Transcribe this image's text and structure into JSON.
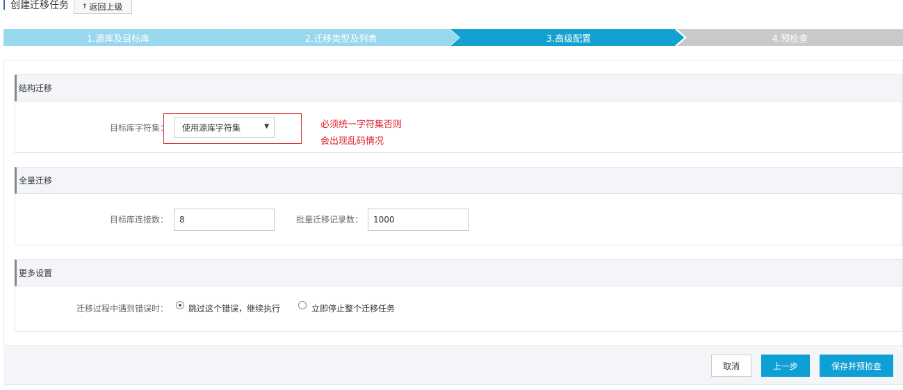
{
  "header": {
    "title": "创建迁移任务",
    "back_label": "返回上级"
  },
  "steps": [
    {
      "label": "1.源库及目标库",
      "state": "done"
    },
    {
      "label": "2.迁移类型及列表",
      "state": "done"
    },
    {
      "label": "3.高级配置",
      "state": "active"
    },
    {
      "label": "4.预检查",
      "state": "pending"
    }
  ],
  "colors": {
    "step_done": "#99d7ef",
    "step_active": "#12a1d1",
    "step_pending": "#c9c9c9",
    "primary_button": "#0e9fd4",
    "annotation_red": "#d9262d"
  },
  "structure_migration": {
    "heading": "结构迁移",
    "charset_label": "目标库字符集：",
    "charset_value": "使用源库字符集",
    "annotation_line1": "必须统一字符集否则",
    "annotation_line2": "会出现乱码情况"
  },
  "full_migration": {
    "heading": "全量迁移",
    "connections_label": "目标库连接数：",
    "connections_value": "8",
    "batch_label": "批量迁移记录数：",
    "batch_value": "1000"
  },
  "more_settings": {
    "heading": "更多设置",
    "error_label": "迁移过程中遇到错误时：",
    "option_skip": "跳过这个错误，继续执行",
    "option_stop": "立即停止整个迁移任务",
    "selected": "skip"
  },
  "footer": {
    "cancel_label": "取消",
    "prev_label": "上一步",
    "save_label": "保存并预检查"
  }
}
